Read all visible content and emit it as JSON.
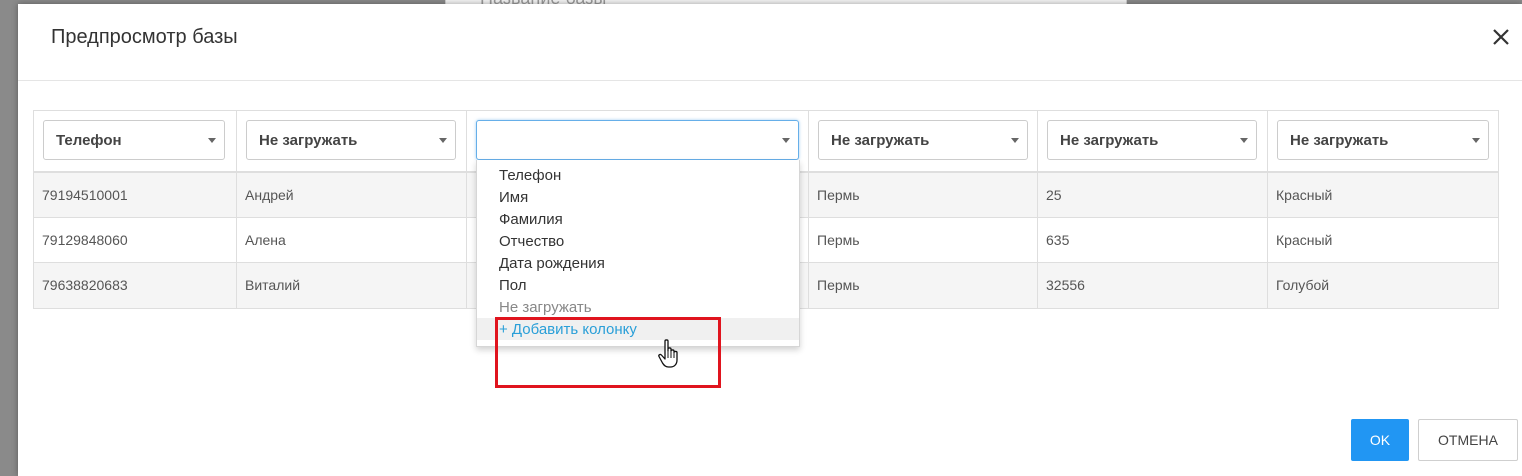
{
  "background": {
    "partial_title": "Название базы"
  },
  "modal": {
    "title": "Предпросмотр базы"
  },
  "columns": [
    {
      "selected": "Телефон"
    },
    {
      "selected": "Не загружать"
    },
    {
      "selected": ""
    },
    {
      "selected": "Не загружать"
    },
    {
      "selected": "Не загружать"
    },
    {
      "selected": "Не загружать"
    }
  ],
  "rows": [
    [
      "79194510001",
      "Андрей",
      "",
      "Пермь",
      "25",
      "Красный"
    ],
    [
      "79129848060",
      "Алена",
      "",
      "Пермь",
      "635",
      "Красный"
    ],
    [
      "79638820683",
      "Виталий",
      "",
      "Пермь",
      "32556",
      "Голубой"
    ]
  ],
  "dropdown": {
    "options": [
      "Телефон",
      "Имя",
      "Фамилия",
      "Отчество",
      "Дата рождения",
      "Пол",
      "Не загружать"
    ],
    "add_column": "+ Добавить колонку"
  },
  "buttons": {
    "ok": "OK",
    "cancel": "ОТМЕНА"
  },
  "colors": {
    "primary": "#2196f3",
    "highlight": "#e0141e",
    "link": "#2a9fd8"
  }
}
